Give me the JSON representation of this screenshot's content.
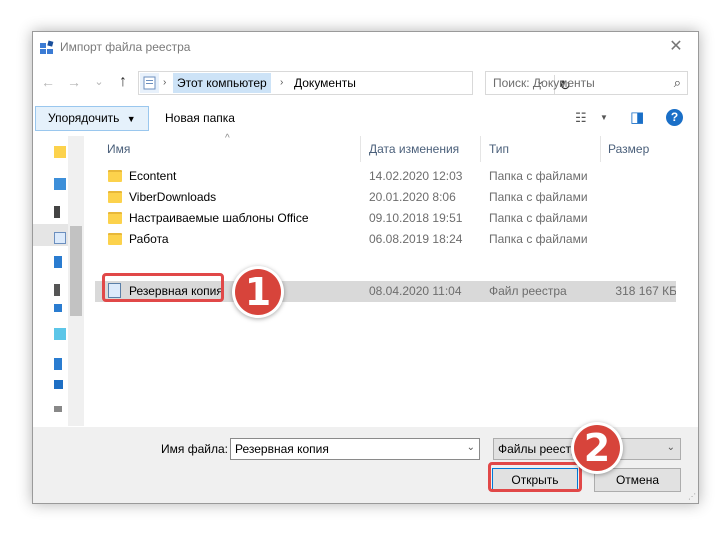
{
  "window": {
    "title": "Импорт файла реестра",
    "close": "✕"
  },
  "nav": {
    "back": "←",
    "forward": "→",
    "dropdown": "⌄",
    "up": "↑"
  },
  "address": {
    "crumbs": [
      "Этот компьютер",
      "Документы"
    ],
    "separator": "›",
    "dropdown": "⌄",
    "refresh": "↻"
  },
  "search": {
    "placeholder": "Поиск: Документы",
    "icon": "⌕"
  },
  "toolbar": {
    "organize_label": "Упорядочить",
    "organize_arrow": "▼",
    "new_folder_label": "Новая папка",
    "view_icon": "☷",
    "view_arrow": "▼",
    "preview_icon": "◨",
    "help_label": "?"
  },
  "columns": {
    "name": "Имя",
    "date": "Дата изменения",
    "type": "Тип",
    "size": "Размер",
    "sort_indicator": "^"
  },
  "files": [
    {
      "name": "Econtent",
      "date": "14.02.2020 12:03",
      "type": "Папка с файлами",
      "size": "",
      "icon": "folder-icon"
    },
    {
      "name": "ViberDownloads",
      "date": "20.01.2020 8:06",
      "type": "Папка с файлами",
      "size": "",
      "icon": "folder-icon"
    },
    {
      "name": "Настраиваемые шаблоны Office",
      "date": "09.10.2018 19:51",
      "type": "Папка с файлами",
      "size": "",
      "icon": "folder-icon"
    },
    {
      "name": "Работа",
      "date": "06.08.2019 18:24",
      "type": "Папка с файлами",
      "size": "",
      "icon": "folder-icon"
    },
    {
      "name": "Резервная копия",
      "date": "08.04.2020 11:04",
      "type": "Файл реестра",
      "size": "318 167 КБ",
      "icon": "registry-file-icon",
      "selected": true
    }
  ],
  "bottom": {
    "filename_label": "Имя файла:",
    "filename_value": "Резервная копия",
    "filetype_value": "Файлы реестра",
    "dropdown": "⌄",
    "open_label": "Открыть",
    "cancel_label": "Отмена"
  },
  "annotations": {
    "step1": "1",
    "step2": "2"
  },
  "colors": {
    "accent": "#0078d7",
    "highlight": "#e14848",
    "badge": "#d7443b",
    "folder": "#fcd24c"
  }
}
